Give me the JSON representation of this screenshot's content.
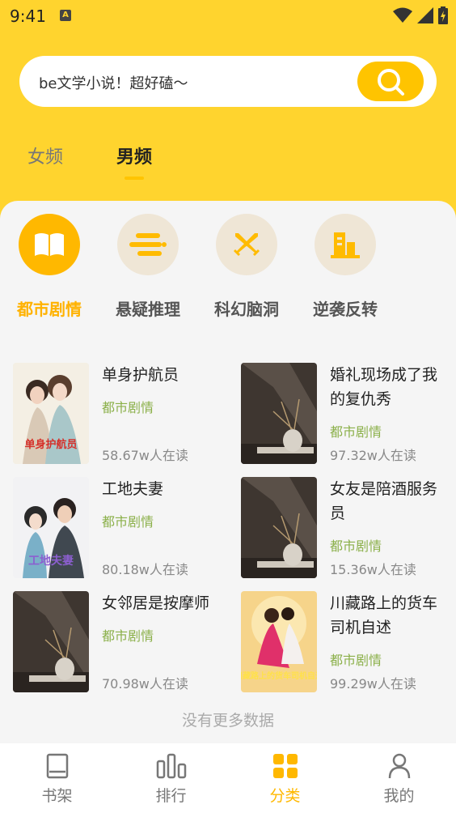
{
  "status": {
    "time": "9:41",
    "badge": "A"
  },
  "search": {
    "placeholder": "be文学小说！超好磕～"
  },
  "tabs": [
    {
      "label": "女频",
      "active": false
    },
    {
      "label": "男频",
      "active": true
    }
  ],
  "categories": [
    {
      "label": "都市剧情",
      "icon": "book-open-icon",
      "active": true
    },
    {
      "label": "悬疑推理",
      "icon": "wind-icon",
      "active": false
    },
    {
      "label": "科幻脑洞",
      "icon": "crossed-swords-icon",
      "active": false
    },
    {
      "label": "逆袭反转",
      "icon": "buildings-icon",
      "active": false
    }
  ],
  "books": [
    {
      "title": "单身护航员",
      "tag": "都市剧情",
      "reads": "58.67w人在读",
      "cover": "couple-cover-1"
    },
    {
      "title": "婚礼现场成了我的复仇秀",
      "tag": "都市剧情",
      "reads": "97.32w人在读",
      "cover": "vase-cover"
    },
    {
      "title": "工地夫妻",
      "tag": "都市剧情",
      "reads": "80.18w人在读",
      "cover": "couple-cover-2"
    },
    {
      "title": "女友是陪酒服务员",
      "tag": "都市剧情",
      "reads": "15.36w人在读",
      "cover": "vase-cover"
    },
    {
      "title": "女邻居是按摩师",
      "tag": "都市剧情",
      "reads": "70.98w人在读",
      "cover": "vase-cover"
    },
    {
      "title": "川藏路上的货车司机自述",
      "tag": "都市剧情",
      "reads": "99.29w人在读",
      "cover": "dance-cover"
    }
  ],
  "covers": {
    "cover0": "单身护航员",
    "cover2": "工地夫妻",
    "cover5": "川藏路上的货车司机自述"
  },
  "no_more": "没有更多数据",
  "bottom_nav": [
    {
      "label": "书架",
      "icon": "bookshelf-icon",
      "active": false
    },
    {
      "label": "排行",
      "icon": "ranking-icon",
      "active": false
    },
    {
      "label": "分类",
      "icon": "category-grid-icon",
      "active": true
    },
    {
      "label": "我的",
      "icon": "profile-icon",
      "active": false
    }
  ],
  "colors": {
    "brand_yellow": "#ffd42e",
    "accent": "#ffb800",
    "tag_green": "#8bb04a"
  }
}
